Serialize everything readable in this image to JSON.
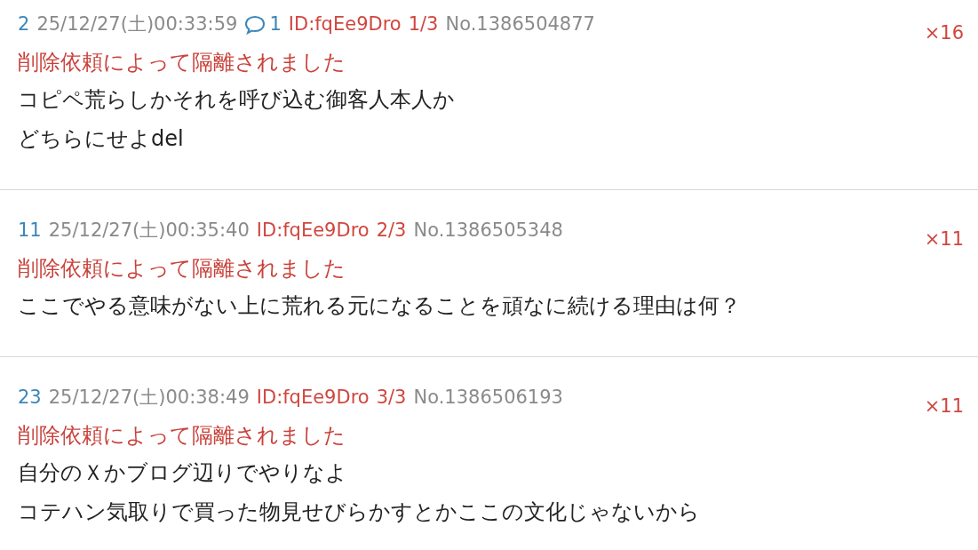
{
  "posts": [
    {
      "number": "2",
      "date": "25/12/27(土)00:33:59",
      "replies": "1",
      "id": "ID:fqEe9Dro",
      "id_count": "1/3",
      "no": "No.1386504877",
      "count": "×16",
      "notice": "削除依頼によって隔離されました",
      "body": [
        "コピペ荒らしかそれを呼び込む御客人本人か",
        "どちらにせよdel"
      ]
    },
    {
      "number": "11",
      "date": "25/12/27(土)00:35:40",
      "id": "ID:fqEe9Dro",
      "id_count": "2/3",
      "no": "No.1386505348",
      "count": "×11",
      "notice": "削除依頼によって隔離されました",
      "body": [
        "ここでやる意味がない上に荒れる元になることを頑なに続ける理由は何？"
      ]
    },
    {
      "number": "23",
      "date": "25/12/27(土)00:38:49",
      "id": "ID:fqEe9Dro",
      "id_count": "3/3",
      "no": "No.1386506193",
      "count": "×11",
      "notice": "削除依頼によって隔離されました",
      "body": [
        "自分のＸかブログ辺りでやりなよ",
        "コテハン気取りで買った物見せびらかすとかここの文化じゃないから"
      ]
    }
  ]
}
